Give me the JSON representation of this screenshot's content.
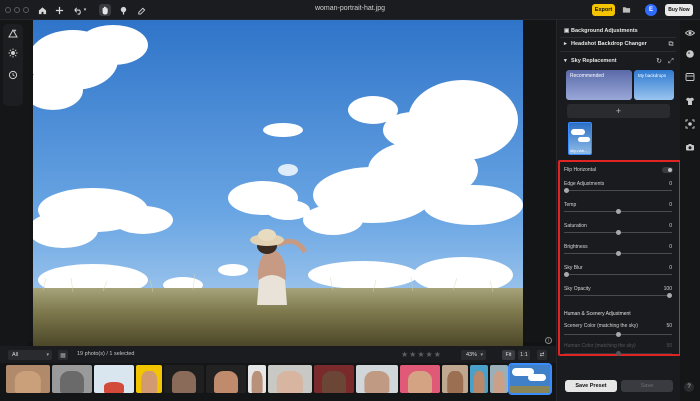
{
  "window": {
    "title": "woman-portrait-hat.jpg"
  },
  "topbar": {
    "export_label": "Export",
    "avatar_initial": "E",
    "buy_label": "Buy Now",
    "undo_caret": "▾"
  },
  "canvas": {
    "info_glyph": "i"
  },
  "filmbar": {
    "filter_value": "All",
    "photo_count": "19 photo(s) / 1 selected",
    "stars": "★★★★★",
    "zoom_value": "43%",
    "fit_label": "Fit",
    "one_label": "1:1",
    "nav_glyph": "⇄"
  },
  "panel": {
    "background_adjustments": "Background Adjustments",
    "headshot_backdrop": "Headshot Backdrop Changer",
    "sky_replacement": "Sky Replacement",
    "card_recommended": "Recommended",
    "card_my_backdrops": "My backdrops",
    "add_glyph": "+",
    "user_sky_label": "sky-nab...",
    "flip_horizontal": "Flip Horizontal",
    "adjustments": [
      {
        "label": "Edge Adjustments",
        "value": "0",
        "level": 0.0
      },
      {
        "label": "Temp",
        "value": "0",
        "level": 0.5
      },
      {
        "label": "Saturation",
        "value": "0",
        "level": 0.5
      },
      {
        "label": "Brightness",
        "value": "0",
        "level": 0.5
      },
      {
        "label": "Sky Blur",
        "value": "0",
        "level": 0.0
      },
      {
        "label": "Sky Opacity",
        "value": "100",
        "level": 1.0
      }
    ],
    "human_scenery_title": "Human & Scenery Adjustment",
    "scenery_color_label": "Scenery Color (matching the sky)",
    "scenery_color_value": "50",
    "human_color_label": "Human Color (matching the sky)",
    "human_color_value": "50",
    "save_preset_label": "Save Preset",
    "save_label": "Save"
  },
  "farrail": {
    "help_glyph": "?"
  },
  "colors": {
    "accent": "#3a8dff",
    "export": "#f5c400",
    "highlight": "#e02424"
  }
}
